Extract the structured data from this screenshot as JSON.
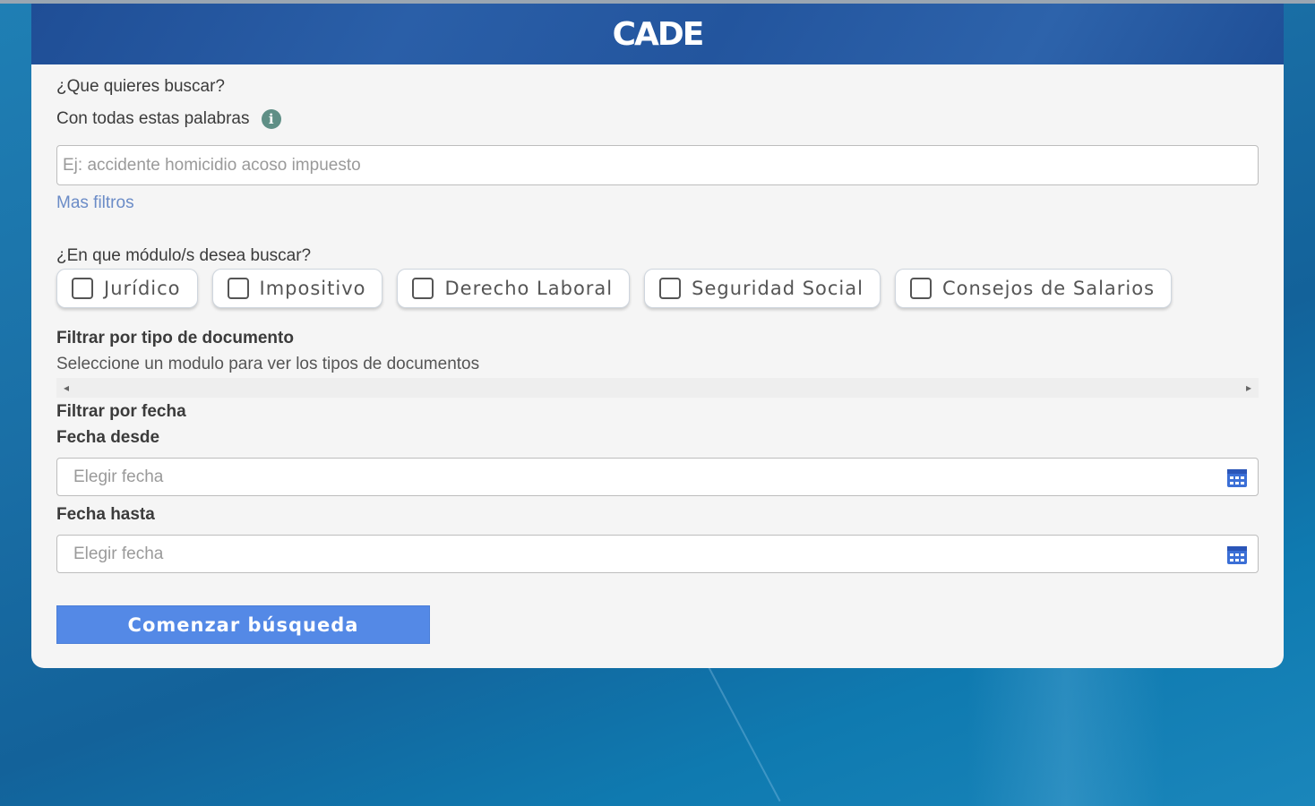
{
  "header": {
    "logo": "CADE"
  },
  "search": {
    "question": "¿Que quieres buscar?",
    "all_words_label": "Con todas estas palabras",
    "info_icon": "i",
    "keywords_placeholder": "Ej: accidente homicidio acoso impuesto",
    "keywords_value": "",
    "more_filters": "Mas filtros"
  },
  "modules": {
    "question": "¿En que módulo/s desea buscar?",
    "items": [
      {
        "label": "Jurídico",
        "checked": false
      },
      {
        "label": "Impositivo",
        "checked": false
      },
      {
        "label": "Derecho Laboral",
        "checked": false
      },
      {
        "label": "Seguridad Social",
        "checked": false
      },
      {
        "label": "Consejos de Salarios",
        "checked": false
      }
    ]
  },
  "doc_type": {
    "title": "Filtrar por tipo de documento",
    "hint": "Seleccione un modulo para ver los tipos de documentos",
    "scroll_left": "◂",
    "scroll_right": "▸"
  },
  "date_filter": {
    "title": "Filtrar por fecha",
    "from_label": "Fecha desde",
    "from_placeholder": "Elegir fecha",
    "to_label": "Fecha hasta",
    "to_placeholder": "Elegir fecha"
  },
  "submit": {
    "label": "Comenzar búsqueda"
  },
  "colors": {
    "accent": "#5489e6",
    "header": "#2a5fa8",
    "link": "#6b8cc7",
    "calendar": "#3b6fd6"
  }
}
